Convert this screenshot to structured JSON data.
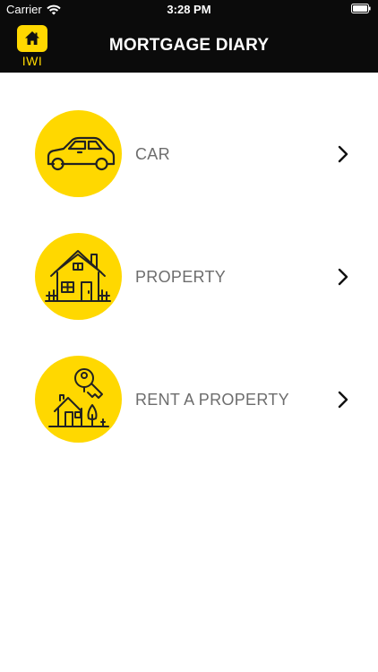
{
  "status_bar": {
    "carrier": "Carrier",
    "time": "3:28 PM"
  },
  "nav_bar": {
    "logo_text": "IWI",
    "title": "MORTGAGE DIARY"
  },
  "menu": {
    "items": [
      {
        "label": "CAR",
        "icon": "car-icon"
      },
      {
        "label": "PROPERTY",
        "icon": "house-icon"
      },
      {
        "label": "RENT A PROPERTY",
        "icon": "rent-key-house-icon"
      }
    ]
  },
  "colors": {
    "accent": "#ffd800",
    "header_bg": "#0b0b0b",
    "label_text": "#6d6d6d"
  }
}
